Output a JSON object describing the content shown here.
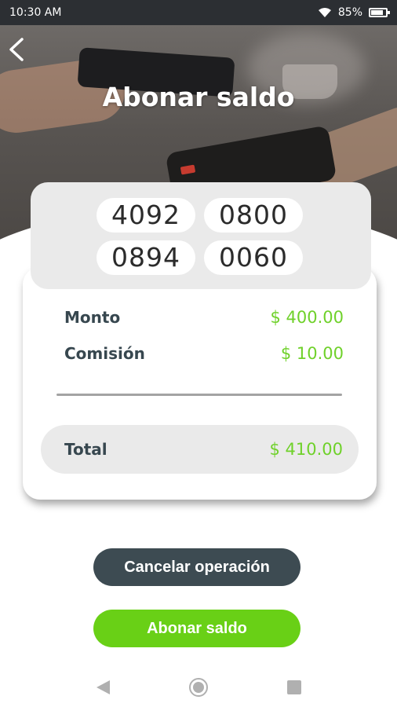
{
  "status_bar": {
    "time": "10:30 AM",
    "battery_percent": "85%",
    "battery_level": 0.85,
    "wifi_icon": "wifi-icon",
    "battery_icon": "battery-icon"
  },
  "header": {
    "title": "Abonar saldo",
    "back_icon": "chevron-left-icon"
  },
  "code": {
    "groups": [
      "4092",
      "0800",
      "0894",
      "0060"
    ]
  },
  "summary": {
    "monto_label": "Monto",
    "monto_value": "$ 400.00",
    "comision_label": "Comisión",
    "comision_value": "$ 10.00",
    "total_label": "Total",
    "total_value": "$ 410.00"
  },
  "actions": {
    "cancel_label": "Cancelar operación",
    "pay_label": "Abonar saldo"
  },
  "nav": {
    "back_icon": "triangle-back-icon",
    "home_icon": "circle-home-icon",
    "recents_icon": "square-recents-icon"
  },
  "colors": {
    "accent": "#69d016",
    "amount": "#6fd12a",
    "dark": "#3d4b52",
    "label": "#37474f",
    "status_bar": "#2c2f33"
  }
}
